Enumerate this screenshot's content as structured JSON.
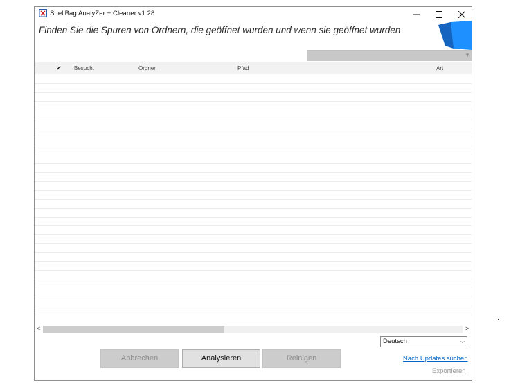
{
  "window": {
    "title": "ShellBag  AnalyZer + Cleaner v1.28",
    "icon": "app-icon",
    "controls": {
      "minimize": "minimize-icon",
      "maximize": "maximize-icon",
      "close": "close-icon"
    }
  },
  "headline": "Finden Sie die Spuren von Ordnern, die geöffnet wurden und wenn sie geöffnet wurden",
  "table": {
    "columns": {
      "check": "✔",
      "visited": "Besucht",
      "folder": "Ordner",
      "path": "Pfad",
      "type": "Art"
    },
    "rows": []
  },
  "language": {
    "selected": "Deutsch"
  },
  "buttons": {
    "cancel": "Abbrechen",
    "analyze": "Analysieren",
    "clean": "Reinigen"
  },
  "links": {
    "updates": "Nach Updates suchen",
    "export": "Exportieren"
  },
  "colors": {
    "accent": "#1e90ff",
    "link": "#0066cc"
  }
}
